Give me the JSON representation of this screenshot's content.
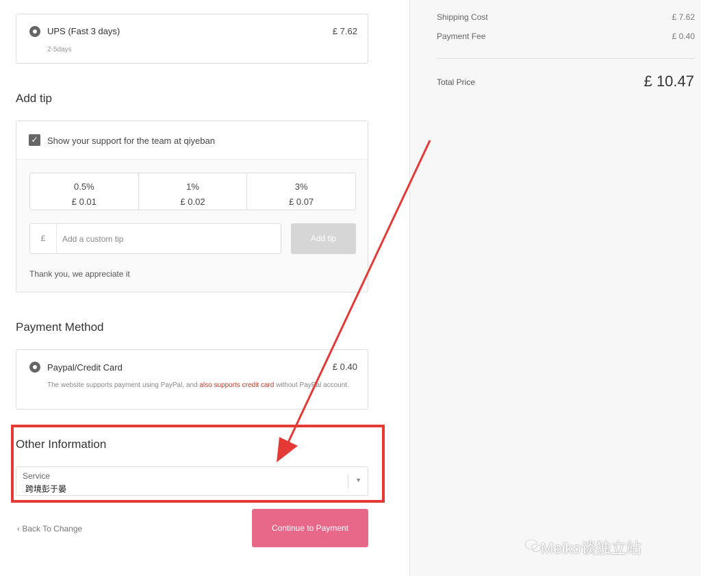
{
  "shipping": {
    "name": "UPS (Fast 3 days)",
    "days": "2-5days",
    "price": "£ 7.62"
  },
  "tip": {
    "title": "Add tip",
    "checkbox_label": "Show your support for the team at qiyeban",
    "options": [
      {
        "percent": "0.5%",
        "amount": "£ 0.01"
      },
      {
        "percent": "1%",
        "amount": "£ 0.02"
      },
      {
        "percent": "3%",
        "amount": "£ 0.07"
      }
    ],
    "currency_symbol": "£",
    "custom_placeholder": "Add a custom tip",
    "add_button": "Add tip",
    "thanks": "Thank you, we appreciate it"
  },
  "payment": {
    "title": "Payment Method",
    "method": "Paypal/Credit Card",
    "price": "£ 0.40",
    "desc_part1": "The website supports payment using PayPal, and ",
    "desc_highlight": "also supports credit card",
    "desc_part2": " without PayPal account."
  },
  "other": {
    "title": "Other Information",
    "service_label": "Service",
    "service_value": "跨境彭于晏"
  },
  "nav": {
    "back": "Back To Change",
    "continue": "Continue to Payment"
  },
  "summary": {
    "shipping_label": "Shipping Cost",
    "shipping_value": "£ 7.62",
    "fee_label": "Payment Fee",
    "fee_value": "£ 0.40",
    "total_label": "Total Price",
    "total_value": "£ 10.47"
  },
  "watermark": {
    "text": "Meiko谈独立站"
  },
  "colors": {
    "accent": "#e8688a",
    "highlight_frame": "#e53935",
    "arrow": "#e53935"
  }
}
